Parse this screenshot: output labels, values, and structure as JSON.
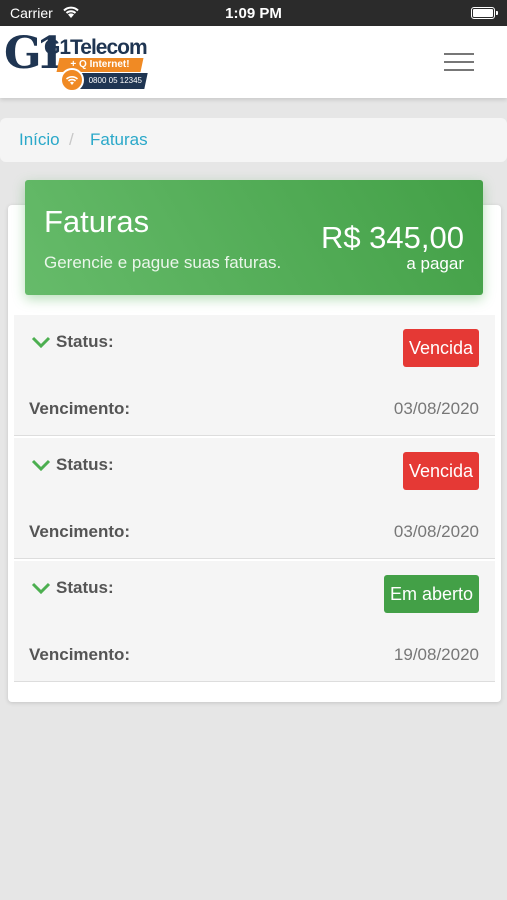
{
  "status_bar": {
    "carrier": "Carrier",
    "time": "1:09 PM"
  },
  "header": {
    "logo": {
      "mark": "G1",
      "brand": "G1Telecom",
      "tagline": "+ Q Internet!",
      "phone": "0800 05 12345"
    },
    "menu_icon": "hamburger-menu-icon"
  },
  "breadcrumb": {
    "home": "Início",
    "separator": "/",
    "current": "Faturas"
  },
  "summary": {
    "title": "Faturas",
    "subtitle": "Gerencie e pague suas faturas.",
    "amount": "R$ 345,00",
    "amount_label": "a pagar",
    "color": "#4caf50"
  },
  "invoices": [
    {
      "status_label": "Status:",
      "status": "Vencida",
      "status_color": "#e53935",
      "due_label": "Vencimento:",
      "due_date": "03/08/2020"
    },
    {
      "status_label": "Status:",
      "status": "Vencida",
      "status_color": "#e53935",
      "due_label": "Vencimento:",
      "due_date": "03/08/2020"
    },
    {
      "status_label": "Status:",
      "status": "Em aberto",
      "status_color": "#43a047",
      "due_label": "Vencimento:",
      "due_date": "19/08/2020"
    }
  ],
  "colors": {
    "link": "#2aa8c9",
    "chevron": "#4caf50"
  }
}
